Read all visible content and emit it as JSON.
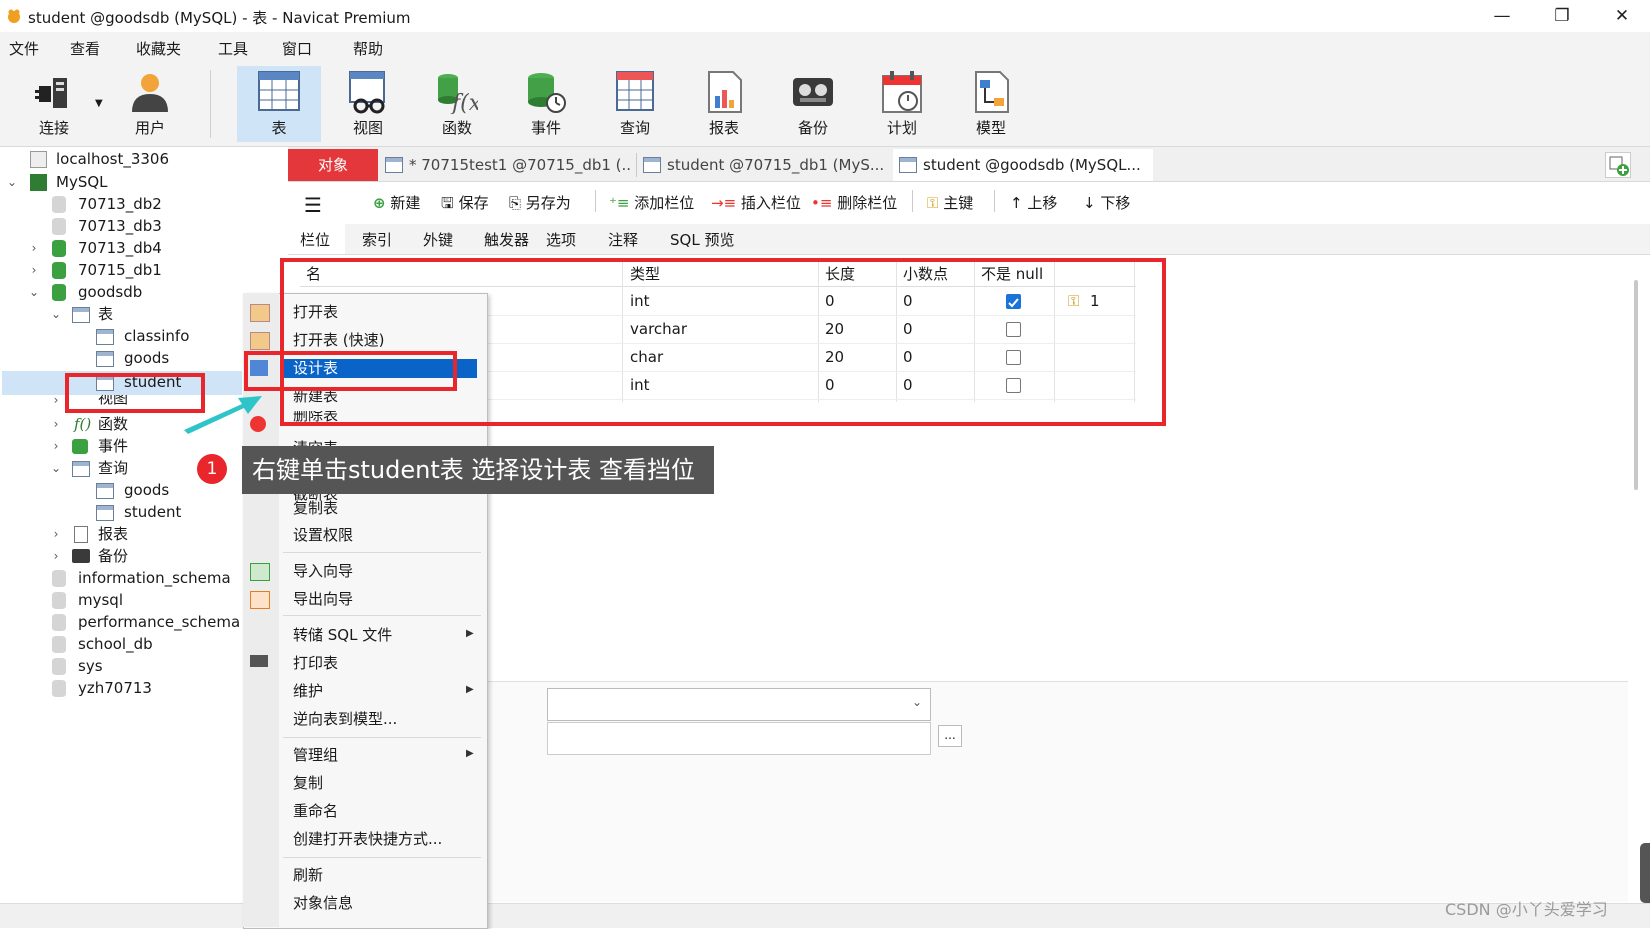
{
  "window": {
    "title": "student @goodsdb (MySQL) - 表 - Navicat Premium",
    "controls": [
      "—",
      "❐",
      "✕"
    ]
  },
  "menubar": [
    "文件",
    "查看",
    "收藏夹",
    "工具",
    "窗口",
    "帮助"
  ],
  "toolbar": [
    {
      "label": "连接",
      "icon": "plug-icon"
    },
    {
      "label": "用户",
      "icon": "user-icon"
    },
    {
      "label": "表",
      "icon": "table-icon",
      "active": true
    },
    {
      "label": "视图",
      "icon": "view-icon"
    },
    {
      "label": "函数",
      "icon": "function-icon"
    },
    {
      "label": "事件",
      "icon": "event-icon"
    },
    {
      "label": "查询",
      "icon": "query-icon"
    },
    {
      "label": "报表",
      "icon": "report-icon"
    },
    {
      "label": "备份",
      "icon": "backup-icon"
    },
    {
      "label": "计划",
      "icon": "schedule-icon"
    },
    {
      "label": "模型",
      "icon": "model-icon"
    }
  ],
  "tree": [
    {
      "label": "localhost_3306",
      "type": "server"
    },
    {
      "label": "MySQL",
      "type": "server-open"
    },
    {
      "label": "70713_db2",
      "type": "db"
    },
    {
      "label": "70713_db3",
      "type": "db"
    },
    {
      "label": "70713_db4",
      "type": "db-open"
    },
    {
      "label": "70715_db1",
      "type": "db-open"
    },
    {
      "label": "goodsdb",
      "type": "db-open"
    },
    {
      "label": "表",
      "type": "folder"
    },
    {
      "label": "classinfo",
      "type": "table"
    },
    {
      "label": "goods",
      "type": "table"
    },
    {
      "label": "student",
      "type": "table",
      "selected": true
    },
    {
      "label": "视图",
      "type": "folder"
    },
    {
      "label": "函数",
      "type": "folder"
    },
    {
      "label": "事件",
      "type": "folder"
    },
    {
      "label": "查询",
      "type": "folder"
    },
    {
      "label": "goods",
      "type": "query"
    },
    {
      "label": "student",
      "type": "query"
    },
    {
      "label": "报表",
      "type": "folder"
    },
    {
      "label": "备份",
      "type": "folder"
    },
    {
      "label": "information_schema",
      "type": "db"
    },
    {
      "label": "mysql",
      "type": "db"
    },
    {
      "label": "performance_schema",
      "type": "db"
    },
    {
      "label": "school_db",
      "type": "db"
    },
    {
      "label": "sys",
      "type": "db"
    },
    {
      "label": "yzh70713",
      "type": "db"
    }
  ],
  "tabs": [
    {
      "label": "对象",
      "active": true
    },
    {
      "label": "* 70715test1 @70715_db1 (..."
    },
    {
      "label": "student @70715_db1 (MyS..."
    },
    {
      "label": "student @goodsdb (MySQL..."
    }
  ],
  "design_toolbar": [
    "新建",
    "保存",
    "另存为",
    "添加栏位",
    "插入栏位",
    "删除栏位",
    "主键",
    "上移",
    "下移"
  ],
  "subtabs": [
    "栏位",
    "索引",
    "外键",
    "触发器",
    "选项",
    "注释",
    "SQL 预览"
  ],
  "grid": {
    "headers": [
      "名",
      "类型",
      "长度",
      "小数点",
      "不是 null"
    ],
    "rows": [
      {
        "type": "int",
        "length": "0",
        "decimals": "0",
        "not_null": true,
        "key": "1"
      },
      {
        "type": "varchar",
        "length": "20",
        "decimals": "0",
        "not_null": false,
        "key": ""
      },
      {
        "type": "char",
        "length": "20",
        "decimals": "0",
        "not_null": false,
        "key": ""
      },
      {
        "type": "int",
        "length": "0",
        "decimals": "0",
        "not_null": false,
        "key": ""
      }
    ]
  },
  "bottom_panel": {
    "ellipsis": "..."
  },
  "context_menu": [
    "打开表",
    "打开表 (快速)",
    "设计表",
    "新建表",
    "删除表",
    "清空表",
    "截断表",
    "复制表",
    "设置权限",
    "导入向导",
    "导出向导",
    "转储 SQL 文件",
    "打印表",
    "维护",
    "逆向表到模型...",
    "管理组",
    "复制",
    "重命名",
    "创建打开表快捷方式...",
    "刷新",
    "对象信息"
  ],
  "annotation": {
    "number": "1",
    "text": "右键单击student表 选择设计表 查看挡位"
  },
  "watermark": "CSDN @小丫头爱学习",
  "colors": {
    "accent": "#e3373b",
    "selection": "#0a64c8",
    "annotation": "#e8262b"
  }
}
